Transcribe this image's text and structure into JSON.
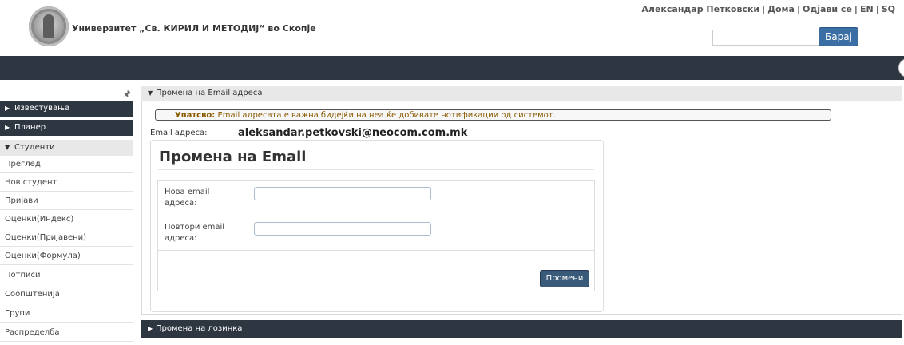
{
  "header": {
    "university_name": "Универзитет „Св. КИРИЛ И МЕТОДИЈ“ во Скопје",
    "user_name": "Александар Петковски",
    "links": [
      "Дома",
      "Одјави се",
      "EN",
      "SQ"
    ],
    "search_placeholder": "",
    "search_button": "Барај"
  },
  "sidebar": {
    "pin_icon": "pin-icon",
    "sections": [
      {
        "label": "Известувања",
        "state": "collapsed"
      },
      {
        "label": "Планер",
        "state": "collapsed"
      },
      {
        "label": "Студенти",
        "state": "expanded"
      }
    ],
    "items": [
      "Преглед",
      "Нов студент",
      "Пријави",
      "Оценки(Индекс)",
      "Оценки(Пријавени)",
      "Оценки(Формула)",
      "Потписи",
      "Соопштенија",
      "Групи",
      "Распределба"
    ]
  },
  "main": {
    "panel_title": "Промена на Email адреса",
    "notice_label": "Упатсво:",
    "notice_text": "Email адресата е важна бидејќи на неа ќе добивате нотификации од системот.",
    "email_label": "Email адреса:",
    "email_value": "aleksandar.petkovski@neocom.com.mk",
    "form_title": "Промена на Email",
    "field1_label": "Нова email адреса:",
    "field1_value": "",
    "field2_label": "Повтори email адреса:",
    "field2_value": "",
    "submit_label": "Промени",
    "panel2_title": "Промена на лозинка"
  },
  "colors": {
    "navbar": "#2e3642",
    "accent_button": "#3a6ea5",
    "notice_text": "#8a5a00"
  }
}
